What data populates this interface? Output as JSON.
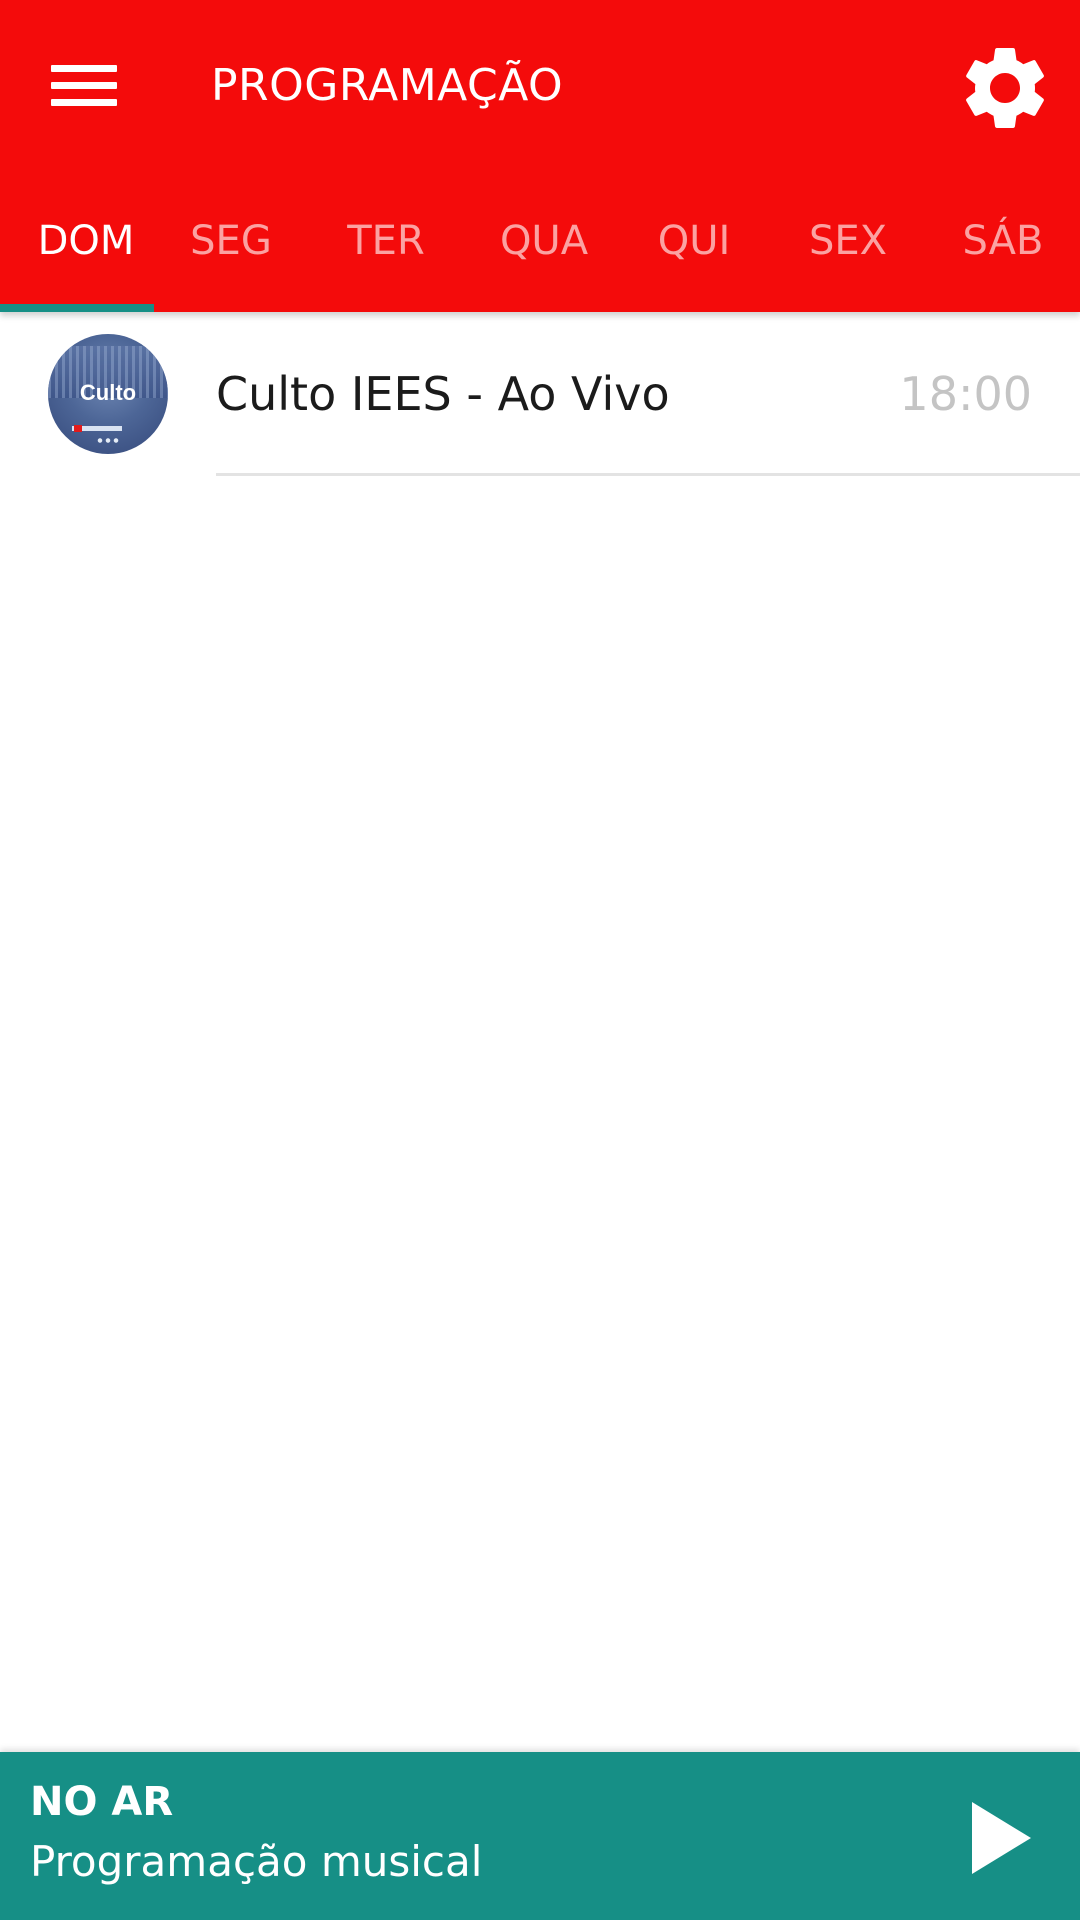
{
  "appbar": {
    "title": "PROGRAMAÇÃO",
    "menu_icon": "hamburger-menu-icon",
    "settings_icon": "gear-icon"
  },
  "tabs": [
    {
      "label": "DOM",
      "active": true
    },
    {
      "label": "SEG",
      "active": false
    },
    {
      "label": "TER",
      "active": false
    },
    {
      "label": "QUA",
      "active": false
    },
    {
      "label": "QUI",
      "active": false
    },
    {
      "label": "SEX",
      "active": false
    },
    {
      "label": "SÁB",
      "active": false
    }
  ],
  "schedule": [
    {
      "thumbnail_text": "Culto",
      "title": "Culto IEES - Ao Vivo",
      "time": "18:00"
    }
  ],
  "now_playing": {
    "label": "NO AR",
    "program": "Programação musical",
    "play_icon": "play-icon"
  },
  "colors": {
    "primary": "#f40b0b",
    "accent": "#168f86",
    "tab_inactive": "rgba(255,255,255,0.62)",
    "time_text": "#c4c4c4",
    "divider": "#e3e3e3"
  }
}
